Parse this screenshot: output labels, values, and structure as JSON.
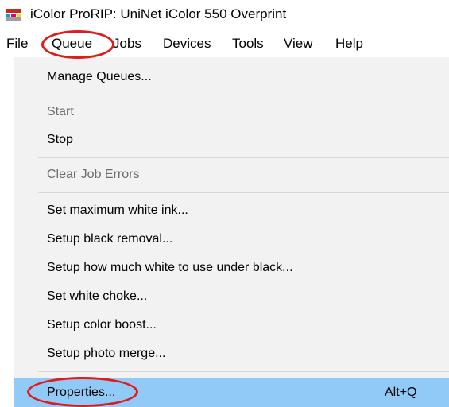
{
  "window": {
    "title": "iColor ProRIP: UniNet iColor 550 Overprint",
    "icon": "uninet-app-icon"
  },
  "menubar": {
    "items": [
      {
        "label": "File"
      },
      {
        "label": "Queue"
      },
      {
        "label": "Jobs"
      },
      {
        "label": "Devices"
      },
      {
        "label": "Tools"
      },
      {
        "label": "View"
      },
      {
        "label": "Help"
      }
    ],
    "active": "Queue"
  },
  "queue_menu": {
    "items": [
      {
        "label": "Manage Queues...",
        "enabled": true
      },
      {
        "label": "Start",
        "enabled": false
      },
      {
        "label": "Stop",
        "enabled": true
      },
      {
        "label": "Clear Job Errors",
        "enabled": false
      },
      {
        "label": "Set maximum white ink...",
        "enabled": true
      },
      {
        "label": "Setup black removal...",
        "enabled": true
      },
      {
        "label": "Setup how much white to use under black...",
        "enabled": true
      },
      {
        "label": "Set white choke...",
        "enabled": true
      },
      {
        "label": "Setup color boost...",
        "enabled": true
      },
      {
        "label": "Setup photo merge...",
        "enabled": true
      },
      {
        "label": "Properties...",
        "enabled": true,
        "shortcut": "Alt+Q",
        "highlighted": true
      }
    ]
  },
  "colors": {
    "highlight": "#91c9f7",
    "menu_background": "#f2f2f2",
    "disabled_text": "#6d6d6d",
    "annotation": "#e01b1b"
  }
}
